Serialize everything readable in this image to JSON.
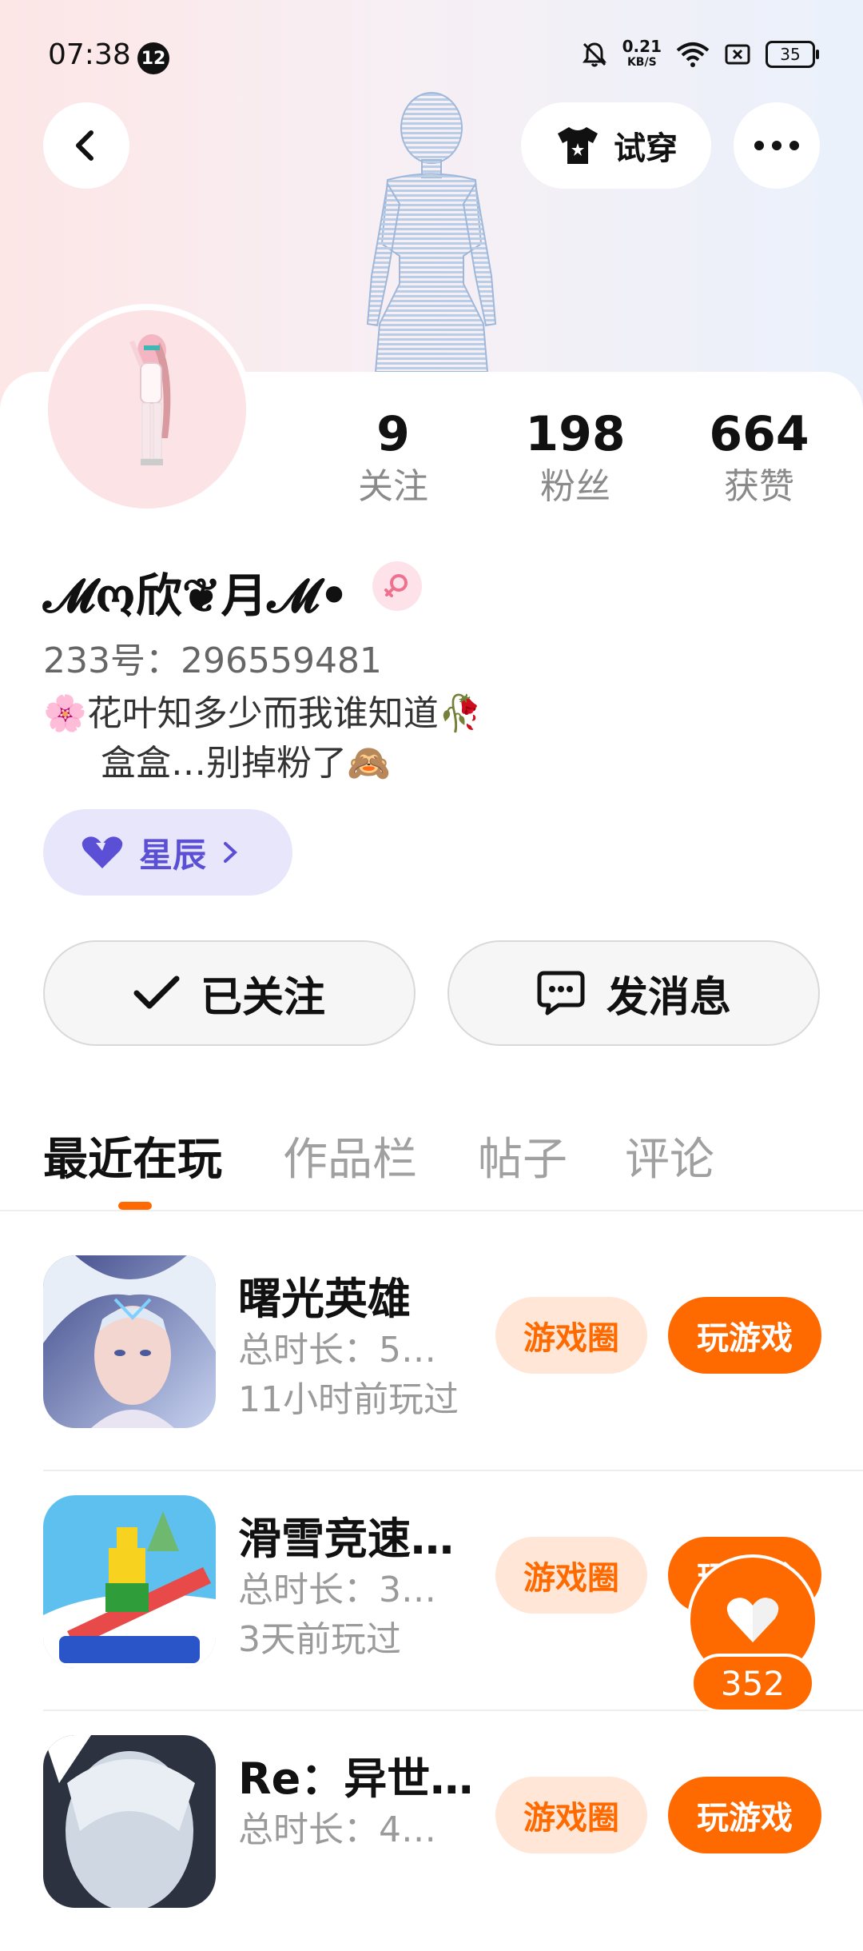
{
  "status_bar": {
    "time": "07:38",
    "notification_count": "12",
    "net_speed_value": "0.21",
    "net_speed_unit": "KB/S",
    "battery": "35"
  },
  "header": {
    "try_on_label": "试穿"
  },
  "stats": [
    {
      "value": "9",
      "label": "关注"
    },
    {
      "value": "198",
      "label": "粉丝"
    },
    {
      "value": "664",
      "label": "获赞"
    }
  ],
  "profile": {
    "nickname": "𝓜ო欣❦月𝓜•",
    "user_id": "233号：296559481",
    "bio_line1": "🌸花叶知多少而我谁知道🥀",
    "bio_line2": "盒盒…别掉粉了🙈",
    "tag_label": "星辰"
  },
  "actions": {
    "follow_label": "已关注",
    "message_label": "发消息"
  },
  "tabs": [
    "最近在玩",
    "作品栏",
    "帖子",
    "评论"
  ],
  "games": [
    {
      "name": "曙光英雄",
      "duration": "总时长：5…",
      "last_played": "11小时前玩过",
      "circle_label": "游戏圈",
      "play_label": "玩游戏"
    },
    {
      "name": "滑雪竞速…",
      "duration": "总时长：3…",
      "last_played": "3天前玩过",
      "circle_label": "游戏圈",
      "play_label": "玩游戏"
    },
    {
      "name": "Re：异世…",
      "duration": "总时长：4…",
      "last_played": "",
      "circle_label": "游戏圈",
      "play_label": "玩游戏"
    }
  ],
  "like_fab": {
    "count": "352"
  },
  "colors": {
    "accent": "#ff6a00",
    "accent_light": "#ffe6d6",
    "tag_bg": "#e8e6fb",
    "tag_text": "#5b4fd6"
  }
}
